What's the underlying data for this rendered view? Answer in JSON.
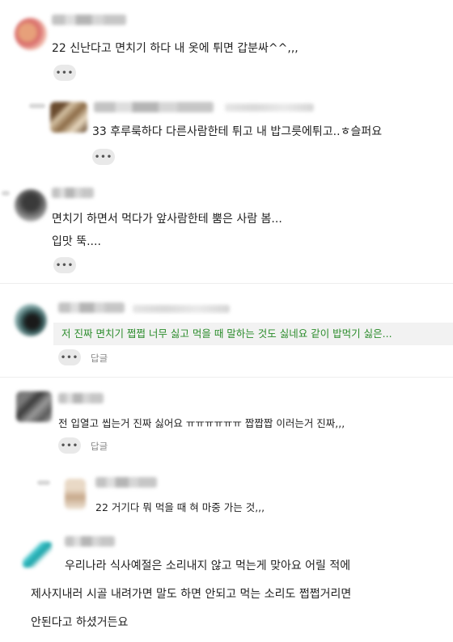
{
  "comments": [
    {
      "text": "22 신난다고 면치기 하다 내 옷에 튀면 갑분싸^^,,,",
      "more": "•••"
    },
    {
      "text": "33 후루룩하다 다른사람한테 튀고 내 밥그릇에튀고..ㅎ슬퍼요",
      "more": "•••"
    },
    {
      "line1": "면치기 하면서 먹다가 앞사람한테 뿜은 사람 봄...",
      "line2": "입맛 뚝....",
      "more": "•••"
    },
    {
      "text": "저 진짜 면치기 쩝쩝 너무 싫고 먹을 때 말하는 것도 싫네요 같이 밥먹기 싫은...",
      "more": "•••",
      "reply": "답글"
    },
    {
      "text": "전 입열고 씹는거 진짜 싫어요 ㅠㅠㅠㅠㅠㅠ 짭짭짭 이러는거 진짜,,,",
      "more": "•••",
      "reply": "답글"
    },
    {
      "text": "22 거기다 뭐 먹을 때 혀 마중 가는 것,,,"
    },
    {
      "line1": "우리나라 식사예절은 소리내지 않고 먹는게 맞아요 어릴 적에",
      "line2": "제사지내러 시골 내려가면 말도 하면 안되고 먹는 소리도 쩝쩝거리면",
      "line3": "안된다고 하셨거든요"
    }
  ],
  "colors": {
    "accent_green": "#2c8c2c",
    "muted": "#888888",
    "button_bg": "#e9e9e9"
  }
}
